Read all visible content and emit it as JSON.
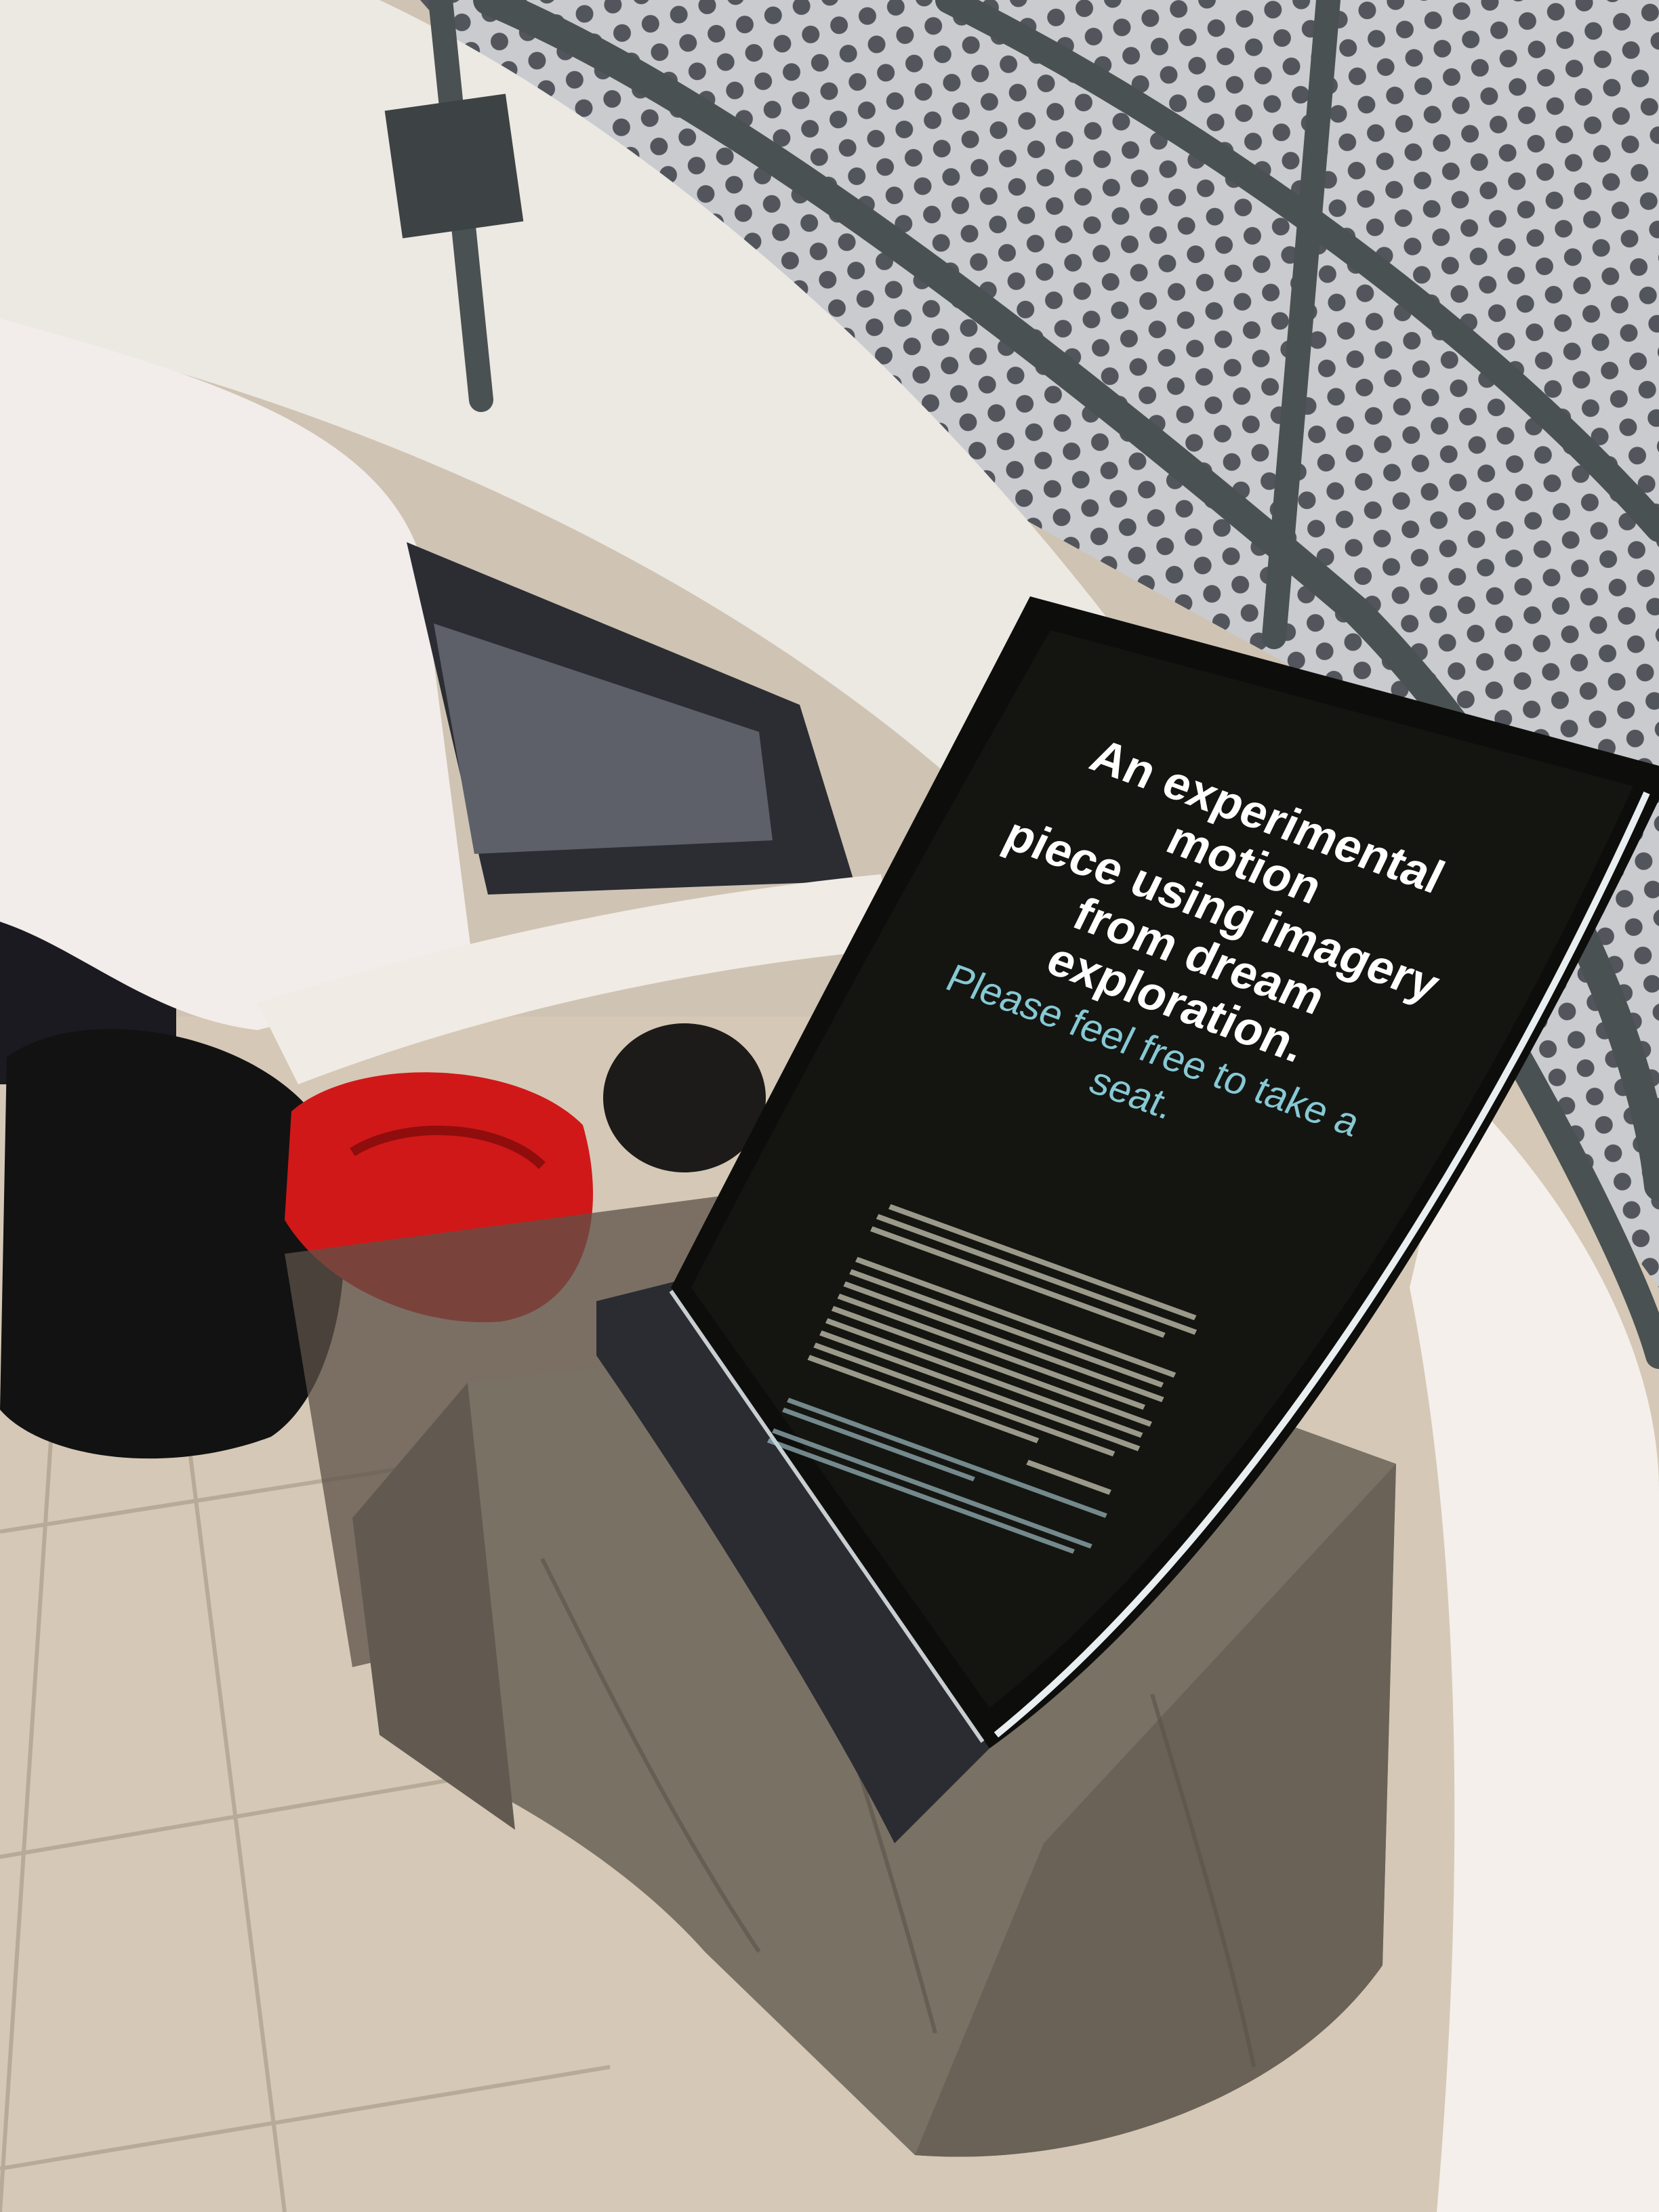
{
  "sign": {
    "headline_lines": [
      "An experimental motion",
      "piece using imagery",
      "from dream exploration."
    ],
    "subline": "Please feel free to take a seat."
  },
  "colors": {
    "sign_background": "#141511",
    "headline": "#ffffff",
    "subline": "#86c9d4",
    "beanbag_red": "#d01818",
    "beanbag_black": "#121212",
    "table_cloth": "#7a7165",
    "floor_tile": "#d5c8b6",
    "railing": "#4a5152"
  }
}
